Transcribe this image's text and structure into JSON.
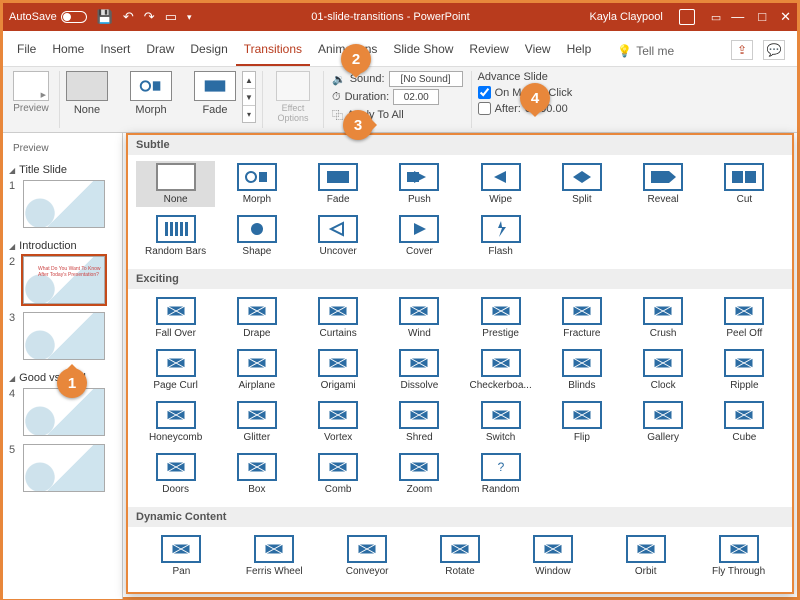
{
  "titlebar": {
    "autosave": "AutoSave",
    "doc": "01-slide-transitions",
    "app": "PowerPoint",
    "user": "Kayla Claypool"
  },
  "tabs": [
    "File",
    "Home",
    "Insert",
    "Draw",
    "Design",
    "Transitions",
    "Animations",
    "Slide Show",
    "Review",
    "View",
    "Help"
  ],
  "active_tab": "Transitions",
  "tell_me": "Tell me",
  "ribbon": {
    "preview": "Preview",
    "gallery": [
      {
        "key": "none",
        "label": "None"
      },
      {
        "key": "morph",
        "label": "Morph"
      },
      {
        "key": "fade",
        "label": "Fade"
      }
    ],
    "selected_gallery": "none",
    "effect_options": "Effect Options",
    "sound_label": "Sound:",
    "sound_value": "[No Sound]",
    "duration_label": "Duration:",
    "duration_value": "02.00",
    "apply_all": "Apply To All",
    "advance_header": "Advance Slide",
    "on_click": "On Mouse Click",
    "after_label": "After:",
    "after_value": "00:00.00"
  },
  "panel": {
    "label": "Preview",
    "sections": [
      {
        "title": "Title Slide",
        "slides": [
          {
            "n": "1"
          }
        ]
      },
      {
        "title": "Introduction",
        "slides": [
          {
            "n": "2",
            "sel": true
          },
          {
            "n": "3"
          }
        ]
      },
      {
        "title": "Good vs. Bad",
        "slides": [
          {
            "n": "4"
          },
          {
            "n": "5"
          }
        ]
      }
    ]
  },
  "dropdown": {
    "categories": [
      {
        "name": "Subtle",
        "cols": 8,
        "items": [
          {
            "k": "none",
            "l": "None",
            "sel": true
          },
          {
            "k": "morph",
            "l": "Morph"
          },
          {
            "k": "fade",
            "l": "Fade"
          },
          {
            "k": "push",
            "l": "Push"
          },
          {
            "k": "wipe",
            "l": "Wipe"
          },
          {
            "k": "split",
            "l": "Split"
          },
          {
            "k": "reveal",
            "l": "Reveal"
          },
          {
            "k": "cut",
            "l": "Cut"
          },
          {
            "k": "randombars",
            "l": "Random Bars"
          },
          {
            "k": "shape",
            "l": "Shape"
          },
          {
            "k": "uncover",
            "l": "Uncover"
          },
          {
            "k": "cover",
            "l": "Cover"
          },
          {
            "k": "flash",
            "l": "Flash"
          }
        ]
      },
      {
        "name": "Exciting",
        "cols": 8,
        "items": [
          {
            "k": "fallover",
            "l": "Fall Over"
          },
          {
            "k": "drape",
            "l": "Drape"
          },
          {
            "k": "curtains",
            "l": "Curtains"
          },
          {
            "k": "wind",
            "l": "Wind"
          },
          {
            "k": "prestige",
            "l": "Prestige"
          },
          {
            "k": "fracture",
            "l": "Fracture"
          },
          {
            "k": "crush",
            "l": "Crush"
          },
          {
            "k": "peeloff",
            "l": "Peel Off"
          },
          {
            "k": "pagecurl",
            "l": "Page Curl"
          },
          {
            "k": "airplane",
            "l": "Airplane"
          },
          {
            "k": "origami",
            "l": "Origami"
          },
          {
            "k": "dissolve",
            "l": "Dissolve"
          },
          {
            "k": "checker",
            "l": "Checkerboa..."
          },
          {
            "k": "blinds",
            "l": "Blinds"
          },
          {
            "k": "clock",
            "l": "Clock"
          },
          {
            "k": "ripple",
            "l": "Ripple"
          },
          {
            "k": "honeycomb",
            "l": "Honeycomb"
          },
          {
            "k": "glitter",
            "l": "Glitter"
          },
          {
            "k": "vortex",
            "l": "Vortex"
          },
          {
            "k": "shred",
            "l": "Shred"
          },
          {
            "k": "switch",
            "l": "Switch"
          },
          {
            "k": "flip",
            "l": "Flip"
          },
          {
            "k": "gallery",
            "l": "Gallery"
          },
          {
            "k": "cube",
            "l": "Cube"
          },
          {
            "k": "doors",
            "l": "Doors"
          },
          {
            "k": "box",
            "l": "Box"
          },
          {
            "k": "comb",
            "l": "Comb"
          },
          {
            "k": "zoom",
            "l": "Zoom"
          },
          {
            "k": "random",
            "l": "Random"
          }
        ]
      },
      {
        "name": "Dynamic Content",
        "cols": 7,
        "items": [
          {
            "k": "pan",
            "l": "Pan"
          },
          {
            "k": "ferris",
            "l": "Ferris Wheel"
          },
          {
            "k": "conveyor",
            "l": "Conveyor"
          },
          {
            "k": "rotate",
            "l": "Rotate"
          },
          {
            "k": "window",
            "l": "Window"
          },
          {
            "k": "orbit",
            "l": "Orbit"
          },
          {
            "k": "flythrough",
            "l": "Fly Through"
          }
        ]
      }
    ]
  },
  "badges": {
    "b1": "1",
    "b2": "2",
    "b3": "3",
    "b4": "4"
  }
}
